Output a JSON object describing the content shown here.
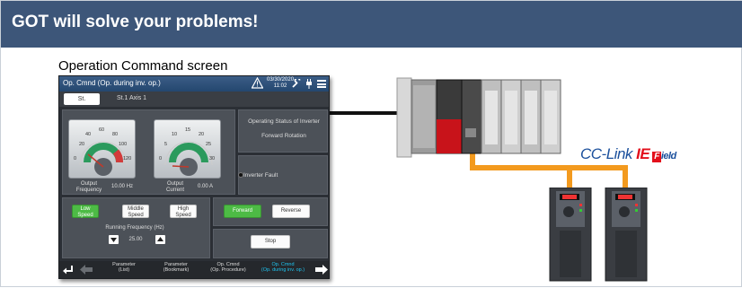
{
  "banner": {
    "title": "GOT will solve your problems!"
  },
  "section": {
    "title": "Operation Command screen"
  },
  "hmi": {
    "title": "Op. Cmnd (Op. during inv. op.)",
    "date": "03/30/2020",
    "time": "11:02",
    "station_tab": "St.",
    "station_axis": "St.1  Axis 1",
    "gauge_freq": {
      "ticks": [
        "0",
        "20",
        "40",
        "60",
        "80",
        "100",
        "120"
      ],
      "label_line1": "Output",
      "label_line2": "Frequency",
      "value": "10.00",
      "unit": "Hz"
    },
    "gauge_curr": {
      "ticks": [
        "0",
        "5",
        "10",
        "15",
        "20",
        "25",
        "30"
      ],
      "label_line1": "Output",
      "label_line2": "Current",
      "value": "0.00",
      "unit": "A"
    },
    "status_title": "Operating Status of Inverter",
    "status_value": "Forward Rotation",
    "fault_label": "Inverter Fault",
    "speed_buttons": [
      {
        "line1": "Low",
        "line2": "Speed"
      },
      {
        "line1": "Middle",
        "line2": "Speed"
      },
      {
        "line1": "High",
        "line2": "Speed"
      }
    ],
    "freq_label": "Running Frequency (Hz)",
    "freq_value": "25.00",
    "forward_label": "Forward",
    "reverse_label": "Reverse",
    "stop_label": "Stop",
    "nav": [
      {
        "line1": "Parameter",
        "line2": "(List)"
      },
      {
        "line1": "Parameter",
        "line2": "(Bookmark)"
      },
      {
        "line1": "Op. Cmnd",
        "line2": "(Op. Procedure)"
      },
      {
        "line1": "Op. Cmnd",
        "line2": "(Op. during inv. op.)"
      }
    ]
  },
  "network": {
    "brand_prefix": "CC-Link",
    "brand_ie": "IE",
    "brand_field_box": "F",
    "brand_field": "ield"
  },
  "colors": {
    "banner": "#3d5679",
    "cable": "#f39a1e",
    "accent_green": "#4dbb45",
    "nav_active": "#1fc3ee"
  }
}
